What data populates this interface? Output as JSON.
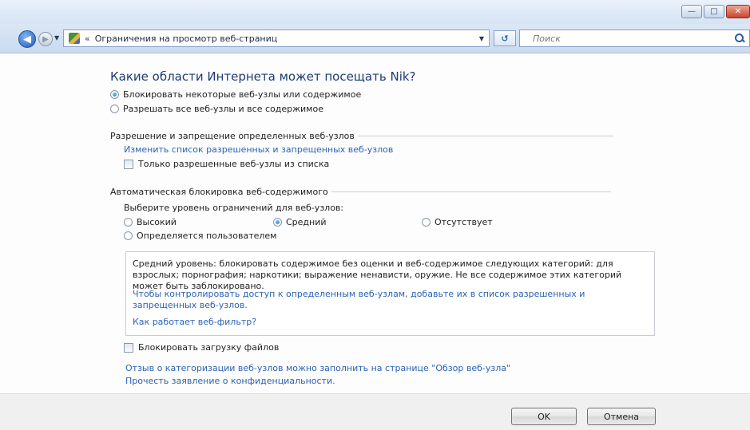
{
  "window": {
    "minimize_glyph": "—",
    "maximize_glyph": "□",
    "close_glyph": "✕"
  },
  "nav": {
    "back_glyph": "◀",
    "forward_glyph": "▶",
    "dropdown_glyph": "▼",
    "breadcrumb_chevron": "«",
    "address": "Ограничения на просмотр веб-страниц",
    "refresh_glyph": "↺",
    "search_placeholder": "Поиск"
  },
  "main": {
    "heading": "Какие области Интернета может посещать Nik?",
    "access_options": [
      {
        "label": "Блокировать некоторые веб-узлы или содержимое",
        "selected": true
      },
      {
        "label": "Разрешать все веб-узлы и все содержимое",
        "selected": false
      }
    ],
    "allow_block_section": {
      "title": "Разрешение и запрещение определенных веб-узлов",
      "edit_link": "Изменить список разрешенных и  запрещенных веб-узлов",
      "only_allowed_checkbox": "Только разрешенные веб-узлы из списка",
      "only_allowed_checked": false
    },
    "auto_block_section": {
      "title": "Автоматическая блокировка веб-содержимого",
      "level_prompt": "Выберите уровень ограничений для веб-узлов:",
      "levels": [
        {
          "label": "Высокий",
          "selected": false
        },
        {
          "label": "Средний",
          "selected": true
        },
        {
          "label": "Отсутствует",
          "selected": false
        },
        {
          "label": "Определяется пользователем",
          "selected": false
        }
      ],
      "description": "Средний уровень: блокировать содержимое без оценки и веб-содержимое следующих категорий: для взрослых; порнография; наркотики; выражение ненависти, оружие. Не все содержимое этих категорий может быть заблокировано.",
      "control_access_link": "Чтобы контролировать доступ к определенным веб-узлам, добавьте их в список разрешенных и запрещенных веб-узлов.",
      "how_filter_works_link": "Как работает веб-фильтр?"
    },
    "block_downloads_checkbox": "Блокировать загрузку файлов",
    "block_downloads_checked": false,
    "feedback_link": "Отзыв о категоризации веб-узлов можно заполнить на странице \"Обзор веб-узла\"",
    "privacy_link": "Прочесть заявление о конфиденциальности."
  },
  "footer": {
    "ok_label": "OK",
    "cancel_label": "Отмена"
  }
}
